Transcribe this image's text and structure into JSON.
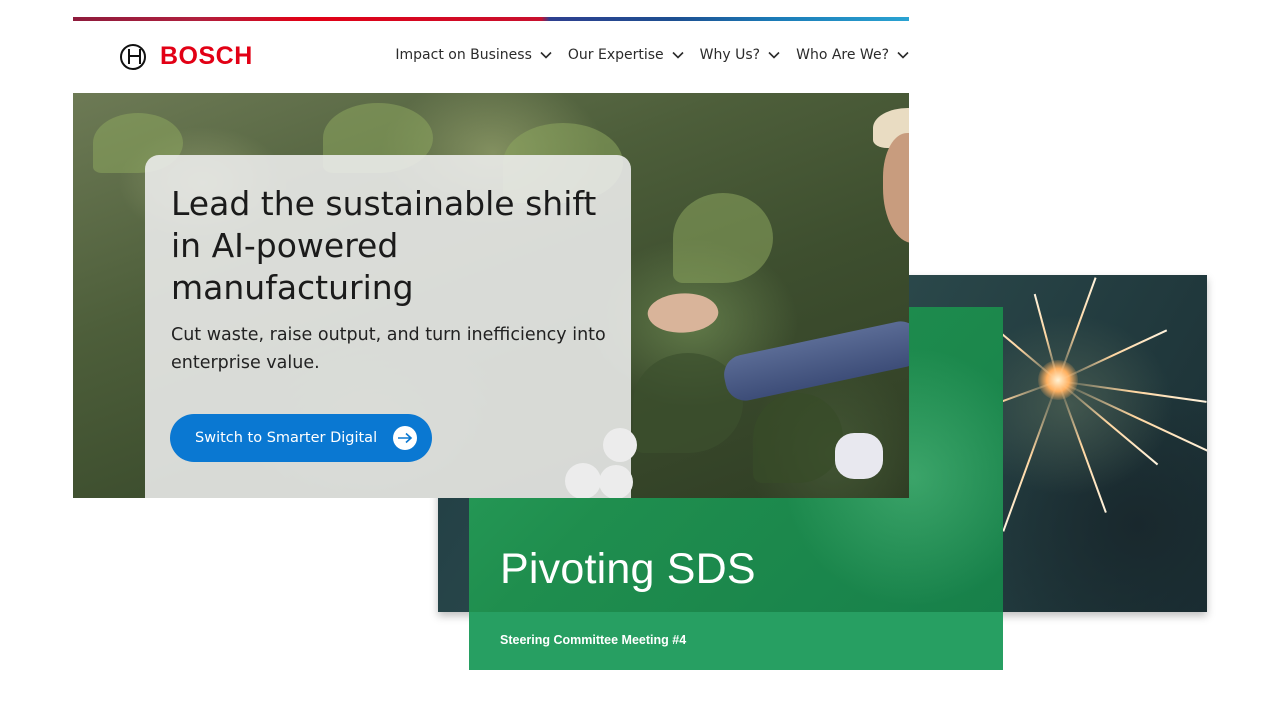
{
  "brand": {
    "name": "BOSCH",
    "logo_icon": "bosch-armature-icon",
    "color": "#e20015"
  },
  "nav": {
    "items": [
      {
        "label": "Impact on Business"
      },
      {
        "label": "Our Expertise"
      },
      {
        "label": "Why Us?"
      },
      {
        "label": "Who Are We?"
      }
    ],
    "chevron_icon": "chevron-down-icon"
  },
  "hero": {
    "title": "Lead the sustainable shift in AI-powered manufacturing",
    "subtitle": "Cut waste, raise output, and turn inefficiency into enterprise value.",
    "cta_label": "Switch to Smarter Digital",
    "cta_icon": "arrow-right-icon",
    "cta_color": "#0a78d2"
  },
  "slide": {
    "title": "Pivoting SDS",
    "subtitle": "Steering Committee Meeting #4",
    "accent_color": "#1f8e4e"
  }
}
